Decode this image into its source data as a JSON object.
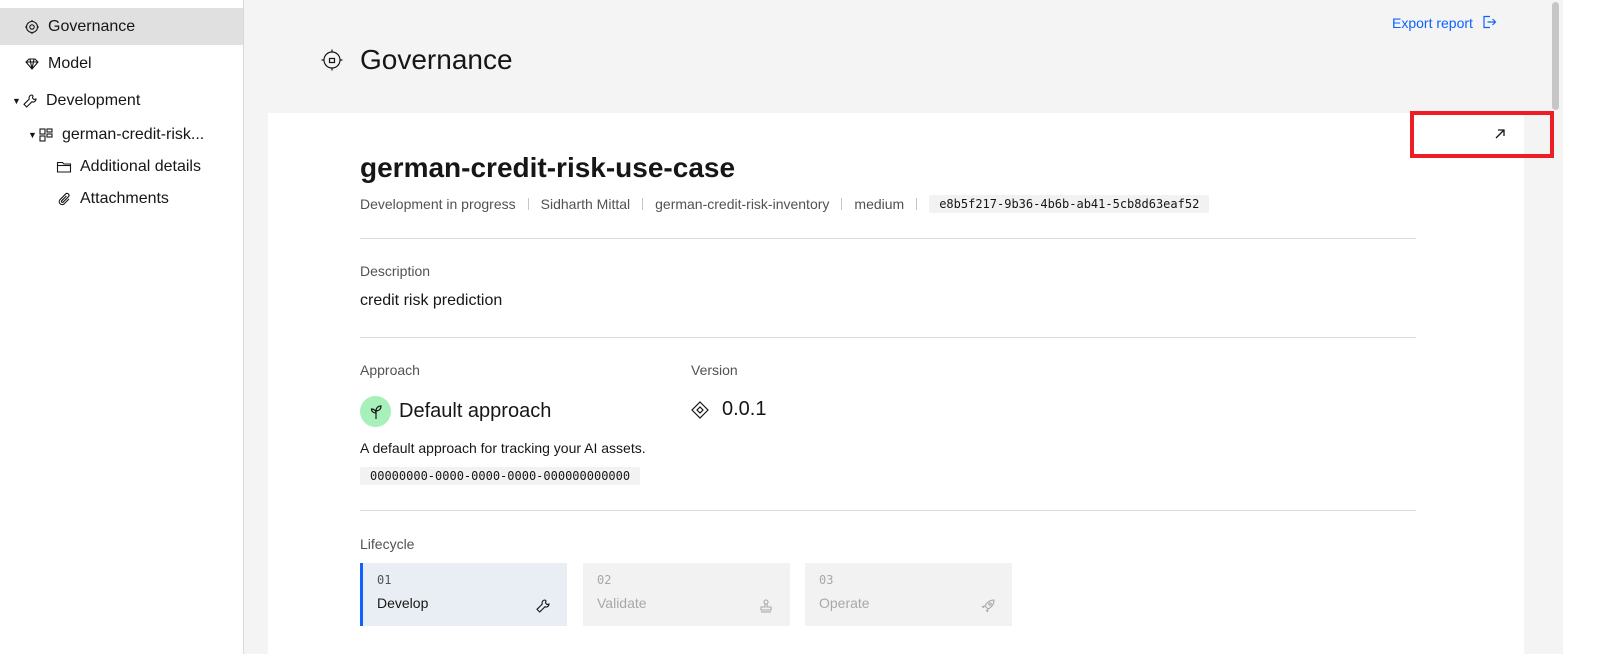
{
  "sidebar": {
    "items": [
      {
        "label": "Governance",
        "icon": "governance-icon"
      },
      {
        "label": "Model",
        "icon": "diamond-icon"
      },
      {
        "label": "Development",
        "icon": "wrench-icon"
      },
      {
        "label": "german-credit-risk...",
        "icon": "use-case-icon"
      },
      {
        "label": "Additional details",
        "icon": "folder-icon"
      },
      {
        "label": "Attachments",
        "icon": "attachment-icon"
      }
    ]
  },
  "header": {
    "title": "Governance",
    "export_label": "Export report"
  },
  "use_case": {
    "title": "german-credit-risk-use-case",
    "status": "Development in progress",
    "owner": "Sidharth Mittal",
    "inventory": "german-credit-risk-inventory",
    "risk": "medium",
    "id": "e8b5f217-9b36-4b6b-ab41-5cb8d63eaf52"
  },
  "description": {
    "label": "Description",
    "value": "credit risk prediction"
  },
  "approach": {
    "label": "Approach",
    "name": "Default approach",
    "description": "A default approach for tracking your AI assets.",
    "id": "00000000-0000-0000-0000-000000000000"
  },
  "version": {
    "label": "Version",
    "value": "0.0.1"
  },
  "lifecycle": {
    "label": "Lifecycle",
    "stages": [
      {
        "num": "01",
        "name": "Develop",
        "icon": "wrench-icon",
        "state": "active"
      },
      {
        "num": "02",
        "name": "Validate",
        "icon": "stamp-icon",
        "state": "disabled"
      },
      {
        "num": "03",
        "name": "Operate",
        "icon": "rocket-icon",
        "state": "disabled"
      }
    ]
  },
  "colors": {
    "accent": "#0f62fe",
    "highlight": "#ee1d23",
    "approach_badge": "#a7f0ba"
  }
}
